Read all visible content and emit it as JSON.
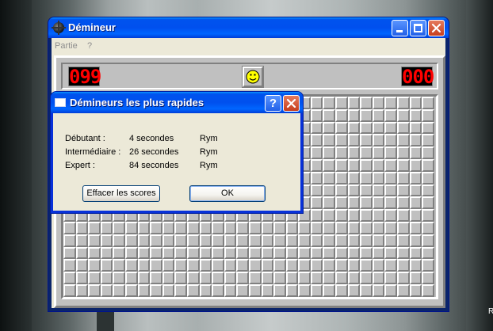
{
  "window": {
    "title": "Démineur",
    "menu": [
      "Partie",
      "?"
    ]
  },
  "game": {
    "mines_counter": "099",
    "timer": "000",
    "smiley": "smiley-face-icon",
    "grid": {
      "columns": 30,
      "rows": 16
    }
  },
  "dialog": {
    "title": "Démineurs les plus rapides",
    "help_label": "?",
    "scores": [
      {
        "level": "Débutant :",
        "time": "4 secondes",
        "name": "Rym"
      },
      {
        "level": "Intermédiaire :",
        "time": "26 secondes",
        "name": "Rym"
      },
      {
        "level": "Expert :",
        "time": "84 secondes",
        "name": "Rym"
      }
    ],
    "reset_label": "Effacer les scores",
    "ok_label": "OK"
  },
  "desktop": {
    "edge_text": "R"
  },
  "colors": {
    "title_blue": "#0053ee",
    "counter_red": "#ff0000",
    "face_yellow": "#ffff00",
    "close_red": "#c73e1d"
  }
}
